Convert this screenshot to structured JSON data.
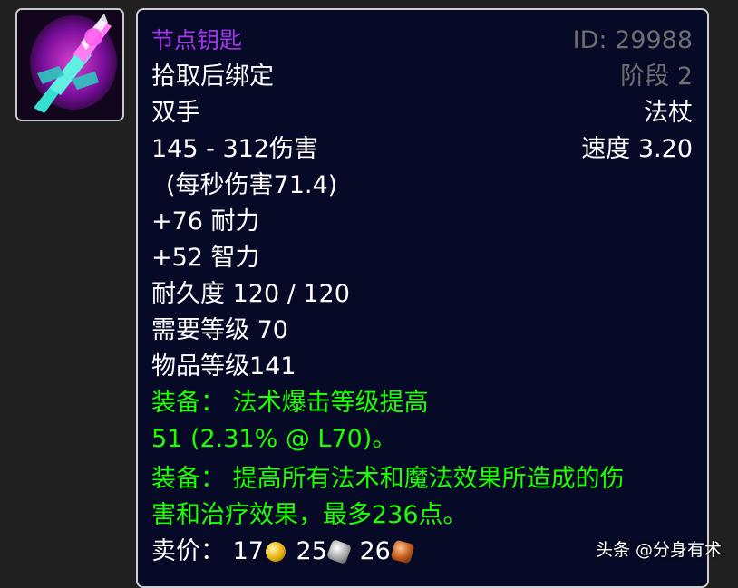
{
  "item": {
    "name": "节点钥匙",
    "id_label": "ID: 29988",
    "binding": "拾取后绑定",
    "phase": "阶段 2",
    "slot": "双手",
    "type": "法杖",
    "damage": "145 - 312伤害",
    "speed": "速度 3.20",
    "dps": "(每秒伤害71.4)",
    "stat1": "+76 耐力",
    "stat2": "+52 智力",
    "durability": "耐久度 120 / 120",
    "required_level": "需要等级 70",
    "item_level": "物品等级141",
    "equip1_line1": "装备： 法术爆击等级提高",
    "equip1_line2": "51 (2.31% @ L70)。",
    "equip2_line1": "装备： 提高所有法术和魔法效果所造成的伤",
    "equip2_line2": "害和治疗效果，最多236点。",
    "sell_label": "卖价：",
    "sell_gold": "17",
    "sell_silver": "25",
    "sell_copper": "26"
  },
  "icon": {
    "name": "staff-icon"
  },
  "watermark": "头条 @分身有术",
  "colors": {
    "tooltip_bg": "#060a26",
    "epic_purple": "#a335ee",
    "equip_green": "#1eff00",
    "grey_text": "#6e6e6e"
  }
}
